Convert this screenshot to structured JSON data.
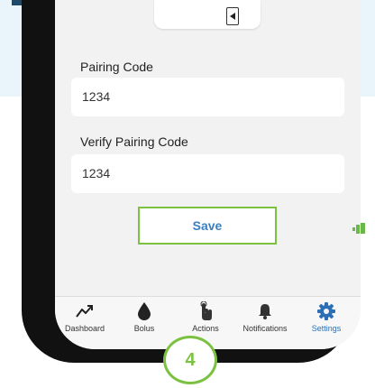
{
  "pairing_code": {
    "label": "Pairing Code",
    "value": "1234"
  },
  "verify_pairing_code": {
    "label": "Verify Pairing Code",
    "value": "1234"
  },
  "save_label": "Save",
  "tabs": [
    {
      "label": "Dashboard",
      "icon": "trend-chart-icon"
    },
    {
      "label": "Bolus",
      "icon": "drop-icon"
    },
    {
      "label": "Actions",
      "icon": "tap-hand-icon"
    },
    {
      "label": "Notifications",
      "icon": "bell-icon"
    },
    {
      "label": "Settings",
      "icon": "gear-icon",
      "active": true
    }
  ],
  "step_badge": "4",
  "colors": {
    "accent_green": "#7cc242",
    "accent_blue": "#2d6fb5",
    "background_band": "#eaf4fb",
    "phone_frame": "#111111"
  }
}
